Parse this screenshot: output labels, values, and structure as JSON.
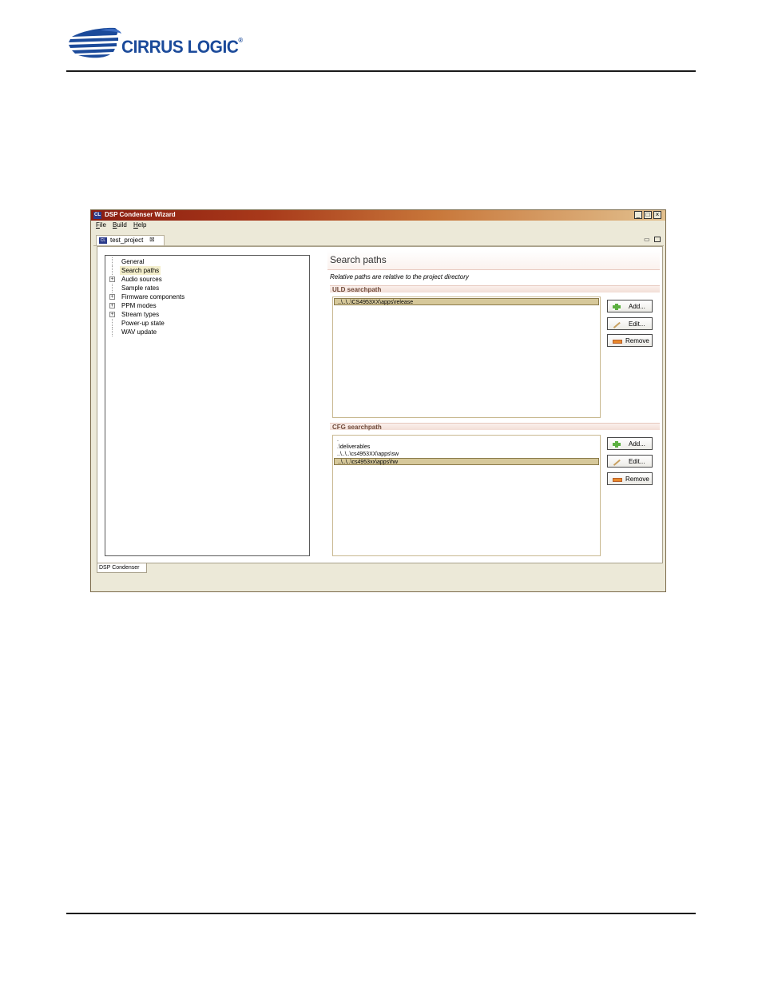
{
  "brand": {
    "name": "CIRRUS LOGIC",
    "registered_mark": "®",
    "colors": {
      "logo_blue": "#1b4a9a",
      "titlebar": "#a8391a"
    }
  },
  "window": {
    "title": "DSP Condenser Wizard",
    "controls": {
      "minimize": "_",
      "maximize": "□",
      "close": "×"
    },
    "menu": [
      {
        "label": "File",
        "mnemonic": "F",
        "rest": "ile"
      },
      {
        "label": "Build",
        "mnemonic": "B",
        "rest": "uild"
      },
      {
        "label": "Help",
        "mnemonic": "H",
        "rest": "elp"
      }
    ],
    "editor_tab": {
      "label": "test_project",
      "close": "⊠"
    },
    "bottom_tab": "DSP Condenser"
  },
  "tree": {
    "items": [
      {
        "label": "General",
        "expandable": false,
        "selected": false
      },
      {
        "label": "Search paths",
        "expandable": false,
        "selected": true
      },
      {
        "label": "Audio sources",
        "expandable": true,
        "selected": false
      },
      {
        "label": "Sample rates",
        "expandable": false,
        "selected": false
      },
      {
        "label": "Firmware components",
        "expandable": true,
        "selected": false
      },
      {
        "label": "PPM modes",
        "expandable": true,
        "selected": false
      },
      {
        "label": "Stream types",
        "expandable": true,
        "selected": false
      },
      {
        "label": "Power-up state",
        "expandable": false,
        "selected": false
      },
      {
        "label": "WAV update",
        "expandable": false,
        "selected": false
      }
    ]
  },
  "search_paths": {
    "title": "Search paths",
    "description": "Relative paths are relative to the project directory",
    "uld": {
      "label": "ULD searchpath",
      "paths": [
        {
          "text": "..\\..\\..\\CS4953XX\\apps\\release",
          "selected": true
        }
      ],
      "buttons": {
        "add": "Add...",
        "edit": "Edit...",
        "remove": "Remove"
      }
    },
    "cfg": {
      "label": "CFG searchpath",
      "paths": [
        {
          "text": ".",
          "selected": false
        },
        {
          "text": ".\\deliverables",
          "selected": false
        },
        {
          "text": "..\\..\\..\\cs4953XX\\apps\\sw",
          "selected": false
        },
        {
          "text": "..\\..\\..\\cs4953xx\\apps\\hw",
          "selected": true
        }
      ],
      "buttons": {
        "add": "Add...",
        "edit": "Edit...",
        "remove": "Remove"
      }
    }
  }
}
